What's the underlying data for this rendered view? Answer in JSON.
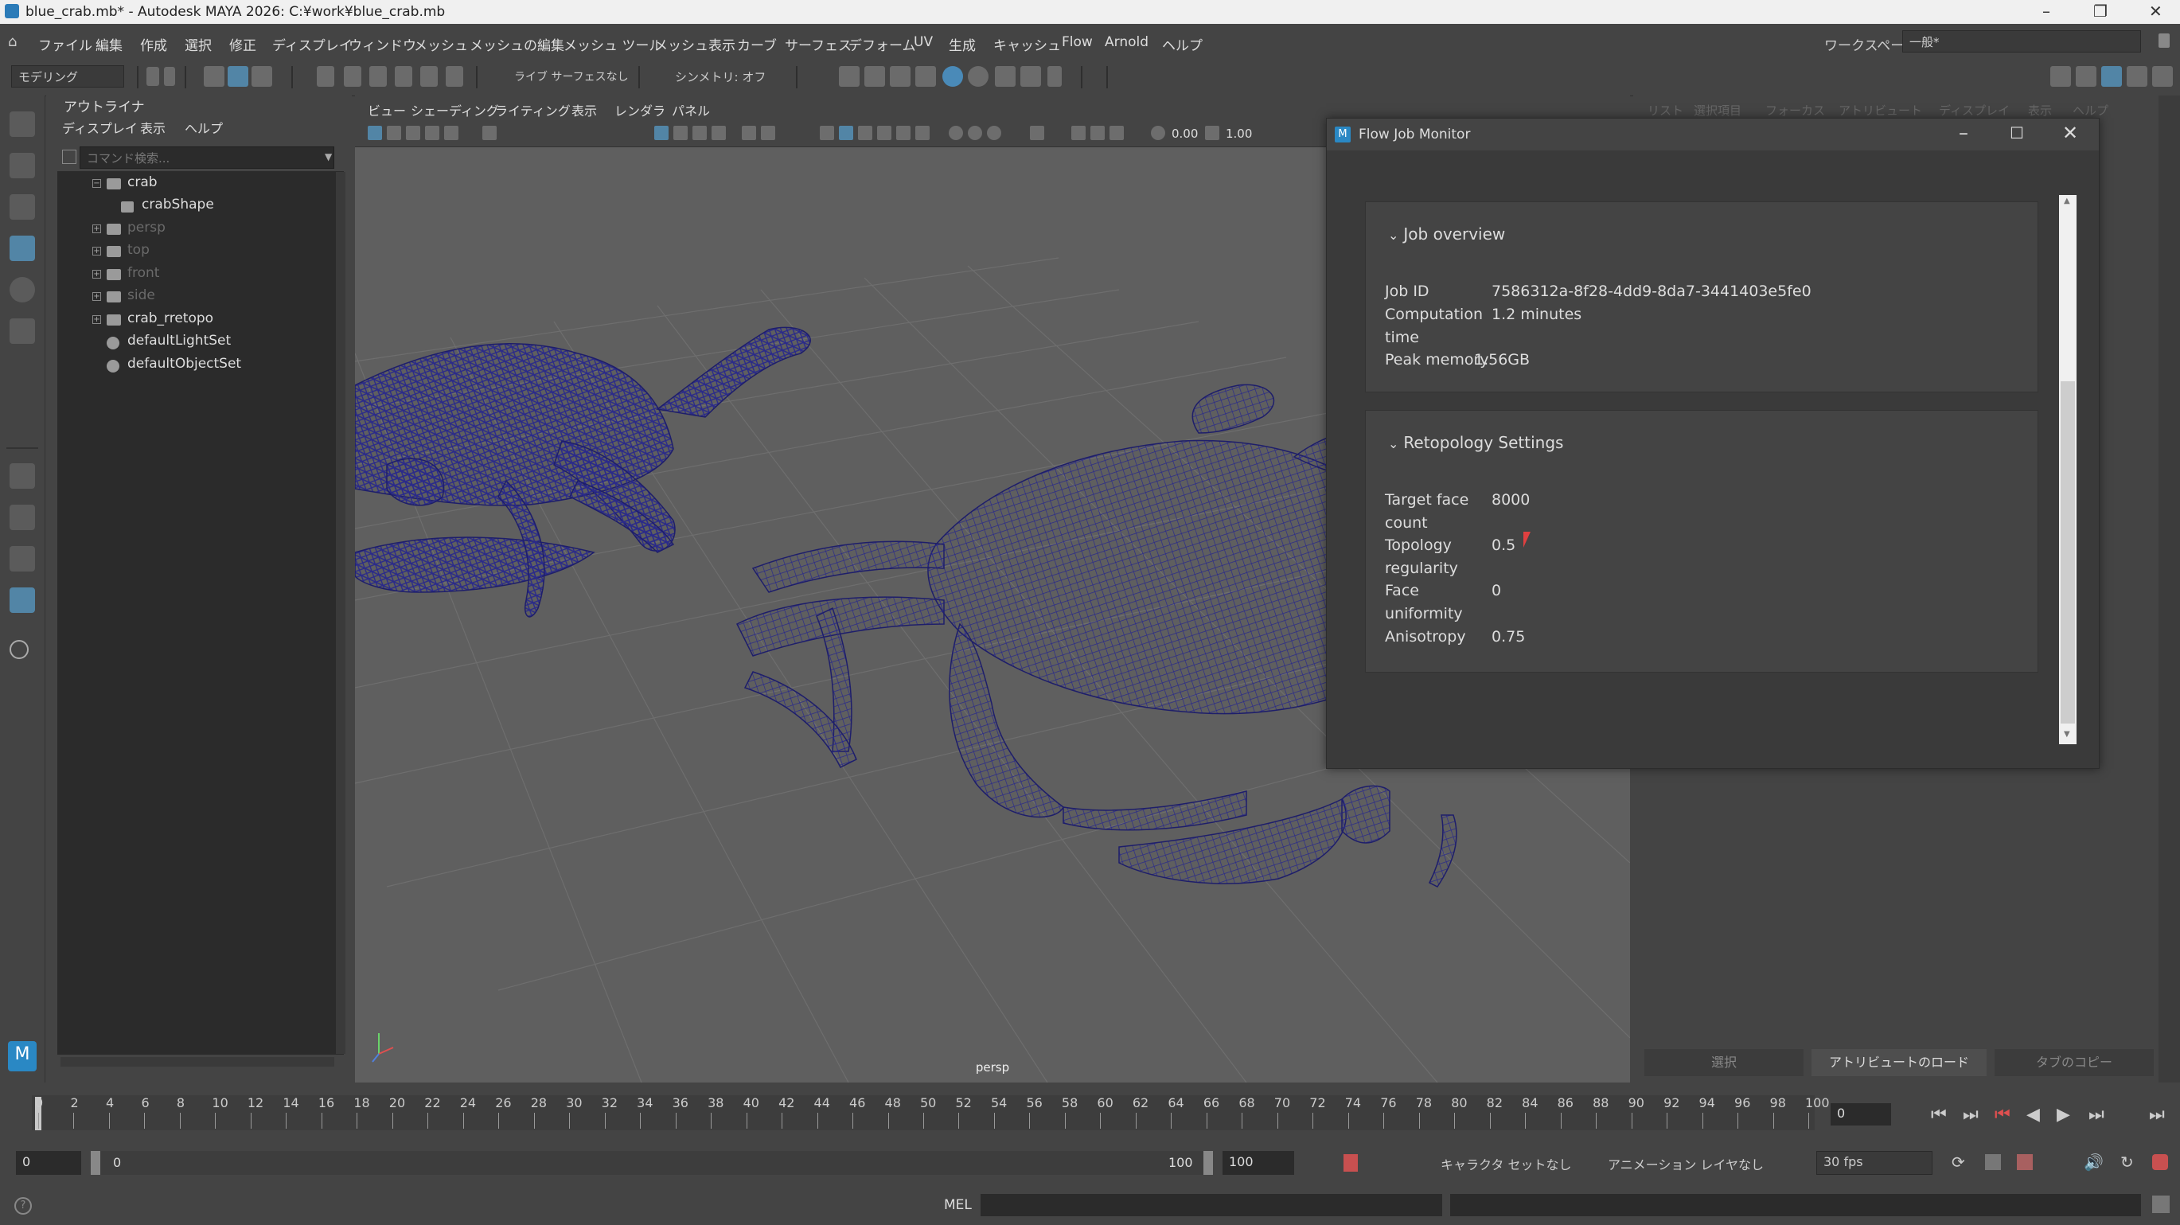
{
  "window": {
    "title": "blue_crab.mb* - Autodesk MAYA 2026: C:¥work¥blue_crab.mb"
  },
  "menubar": {
    "items": [
      "ファイル",
      "編集",
      "作成",
      "選択",
      "修正",
      "ディスプレイ",
      "ウィンドウ",
      "メッシュ",
      "メッシュの編集",
      "メッシュ ツール",
      "メッシュ表示",
      "カーブ",
      "サーフェス",
      "デフォーム",
      "UV",
      "生成",
      "キャッシュ",
      "Flow",
      "Arnold",
      "ヘルプ"
    ],
    "workspace_label": "ワークスペース:",
    "workspace_value": "一般*"
  },
  "shelf": {
    "mode": "モデリング",
    "live_surface": "ライブ サーフェスなし",
    "symmetry": "シンメトリ: オフ"
  },
  "outliner": {
    "title": "アウトライナ",
    "menu": [
      "ディスプレイ",
      "表示",
      "ヘルプ"
    ],
    "search_placeholder": "コマンド検索...",
    "nodes": [
      {
        "label": "crab"
      },
      {
        "label": "crabShape"
      },
      {
        "label": "persp"
      },
      {
        "label": "top"
      },
      {
        "label": "front"
      },
      {
        "label": "side"
      },
      {
        "label": "crab_rretopo"
      },
      {
        "label": "defaultLightSet"
      },
      {
        "label": "defaultObjectSet"
      }
    ]
  },
  "viewport": {
    "menu": [
      "ビュー",
      "シェーディング",
      "ライティング",
      "表示",
      "レンダラ",
      "パネル"
    ],
    "exposure": "0.00",
    "gamma": "1.00",
    "camera_label": "persp",
    "mesh_color": "#2a2a8a"
  },
  "right_panel": {
    "top_menu": [
      "リスト",
      "選択項目",
      "フォーカス",
      "アトリビュート",
      "ディスプレイ",
      "表示",
      "ヘルプ"
    ],
    "tabs": [
      "選択",
      "アトリビュートのロード",
      "タブのコピー"
    ]
  },
  "timeline": {
    "ticks": [
      "0",
      "2",
      "4",
      "6",
      "8",
      "10",
      "12",
      "14",
      "16",
      "18",
      "20",
      "22",
      "24",
      "26",
      "28",
      "30",
      "32",
      "34",
      "36",
      "38",
      "40",
      "42",
      "44",
      "46",
      "48",
      "50",
      "52",
      "54",
      "56",
      "58",
      "60",
      "62",
      "64",
      "66",
      "68",
      "70",
      "72",
      "74",
      "76",
      "78",
      "80",
      "82",
      "84",
      "86",
      "88",
      "90",
      "92",
      "94",
      "96",
      "98",
      "100"
    ],
    "current_frame": "0"
  },
  "range": {
    "start": "0",
    "inner_start": "0",
    "inner_end": "100",
    "end": "100",
    "character_set": "キャラクタ セットなし",
    "anim_layer": "アニメーション レイヤなし",
    "fps": "30 fps"
  },
  "cmdline": {
    "lang": "MEL"
  },
  "flow_monitor": {
    "title": "Flow Job Monitor",
    "overview": {
      "header": "Job overview",
      "rows": [
        {
          "key": "Job ID",
          "value": "7586312a-8f28-4dd9-8da7-3441403e5fe0"
        },
        {
          "key": "Computation time",
          "value": "1.2 minutes"
        },
        {
          "key": "Peak memory",
          "value": "1.56GB"
        }
      ]
    },
    "retopo": {
      "header": "Retopology Settings",
      "rows": [
        {
          "key": "Target face count",
          "value": "8000"
        },
        {
          "key": "Topology regularity",
          "value": "0.5"
        },
        {
          "key": "Face uniformity",
          "value": "0"
        },
        {
          "key": "Anisotropy",
          "value": "0.75"
        }
      ]
    }
  }
}
